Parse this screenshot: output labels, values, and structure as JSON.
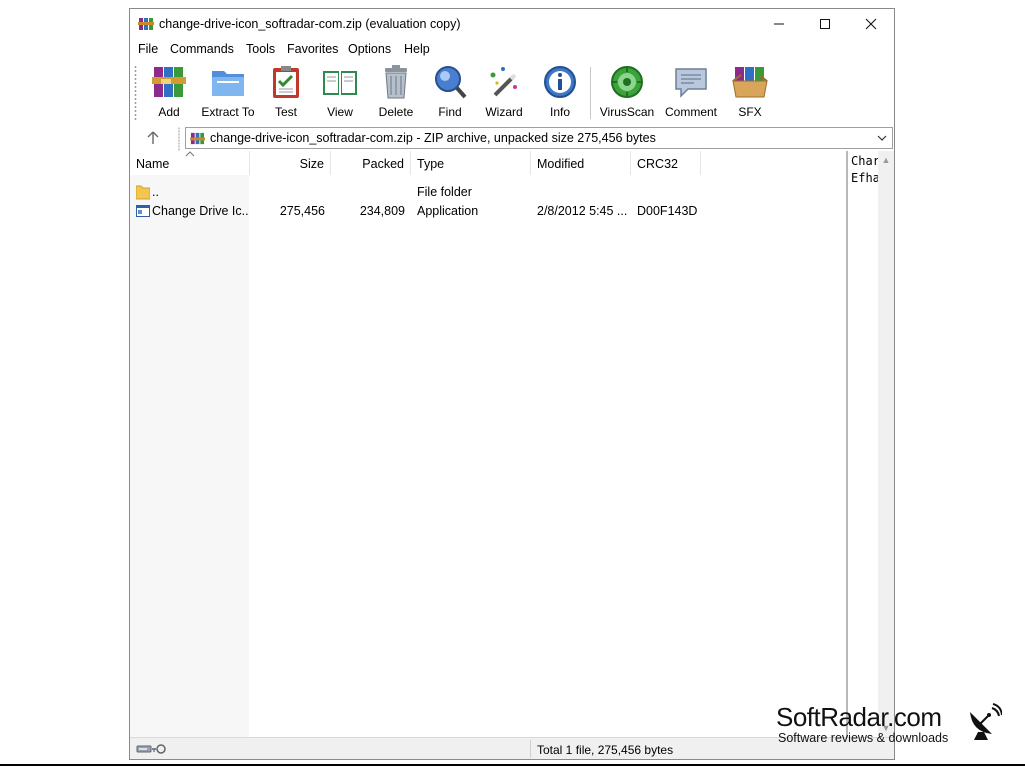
{
  "window": {
    "title": "change-drive-icon_softradar-com.zip (evaluation copy)"
  },
  "menu": [
    "File",
    "Commands",
    "Tools",
    "Favorites",
    "Options",
    "Help"
  ],
  "toolbar": [
    {
      "label": "Add",
      "icon": "add-icon"
    },
    {
      "label": "Extract To",
      "icon": "extract-folder-icon"
    },
    {
      "label": "Test",
      "icon": "test-clipboard-icon"
    },
    {
      "label": "View",
      "icon": "view-book-icon"
    },
    {
      "label": "Delete",
      "icon": "trash-icon"
    },
    {
      "label": "Find",
      "icon": "magnifier-icon"
    },
    {
      "label": "Wizard",
      "icon": "magic-wand-icon"
    },
    {
      "label": "Info",
      "icon": "info-icon"
    },
    {
      "label": "VirusScan",
      "icon": "virus-scan-icon"
    },
    {
      "label": "Comment",
      "icon": "comment-icon"
    },
    {
      "label": "SFX",
      "icon": "sfx-box-icon"
    }
  ],
  "address": {
    "text": "change-drive-icon_softradar-com.zip - ZIP archive, unpacked size 275,456 bytes"
  },
  "columns": [
    "Name",
    "Size",
    "Packed",
    "Type",
    "Modified",
    "CRC32"
  ],
  "rows": [
    {
      "name": "..",
      "size": "",
      "packed": "",
      "type": "File folder",
      "modified": "",
      "crc": "",
      "icon": "folder-icon"
    },
    {
      "name": "Change Drive Ic...",
      "size": "275,456",
      "packed": "234,809",
      "type": "Application",
      "modified": "2/8/2012 5:45 ...",
      "crc": "D00F143D",
      "icon": "application-icon"
    }
  ],
  "comment": {
    "line1": "Char",
    "line2": "Efha"
  },
  "status": {
    "text": "Total 1 file, 275,456 bytes"
  },
  "watermark": {
    "brand": "SoftRadar.com",
    "tagline": "Software reviews & downloads"
  }
}
